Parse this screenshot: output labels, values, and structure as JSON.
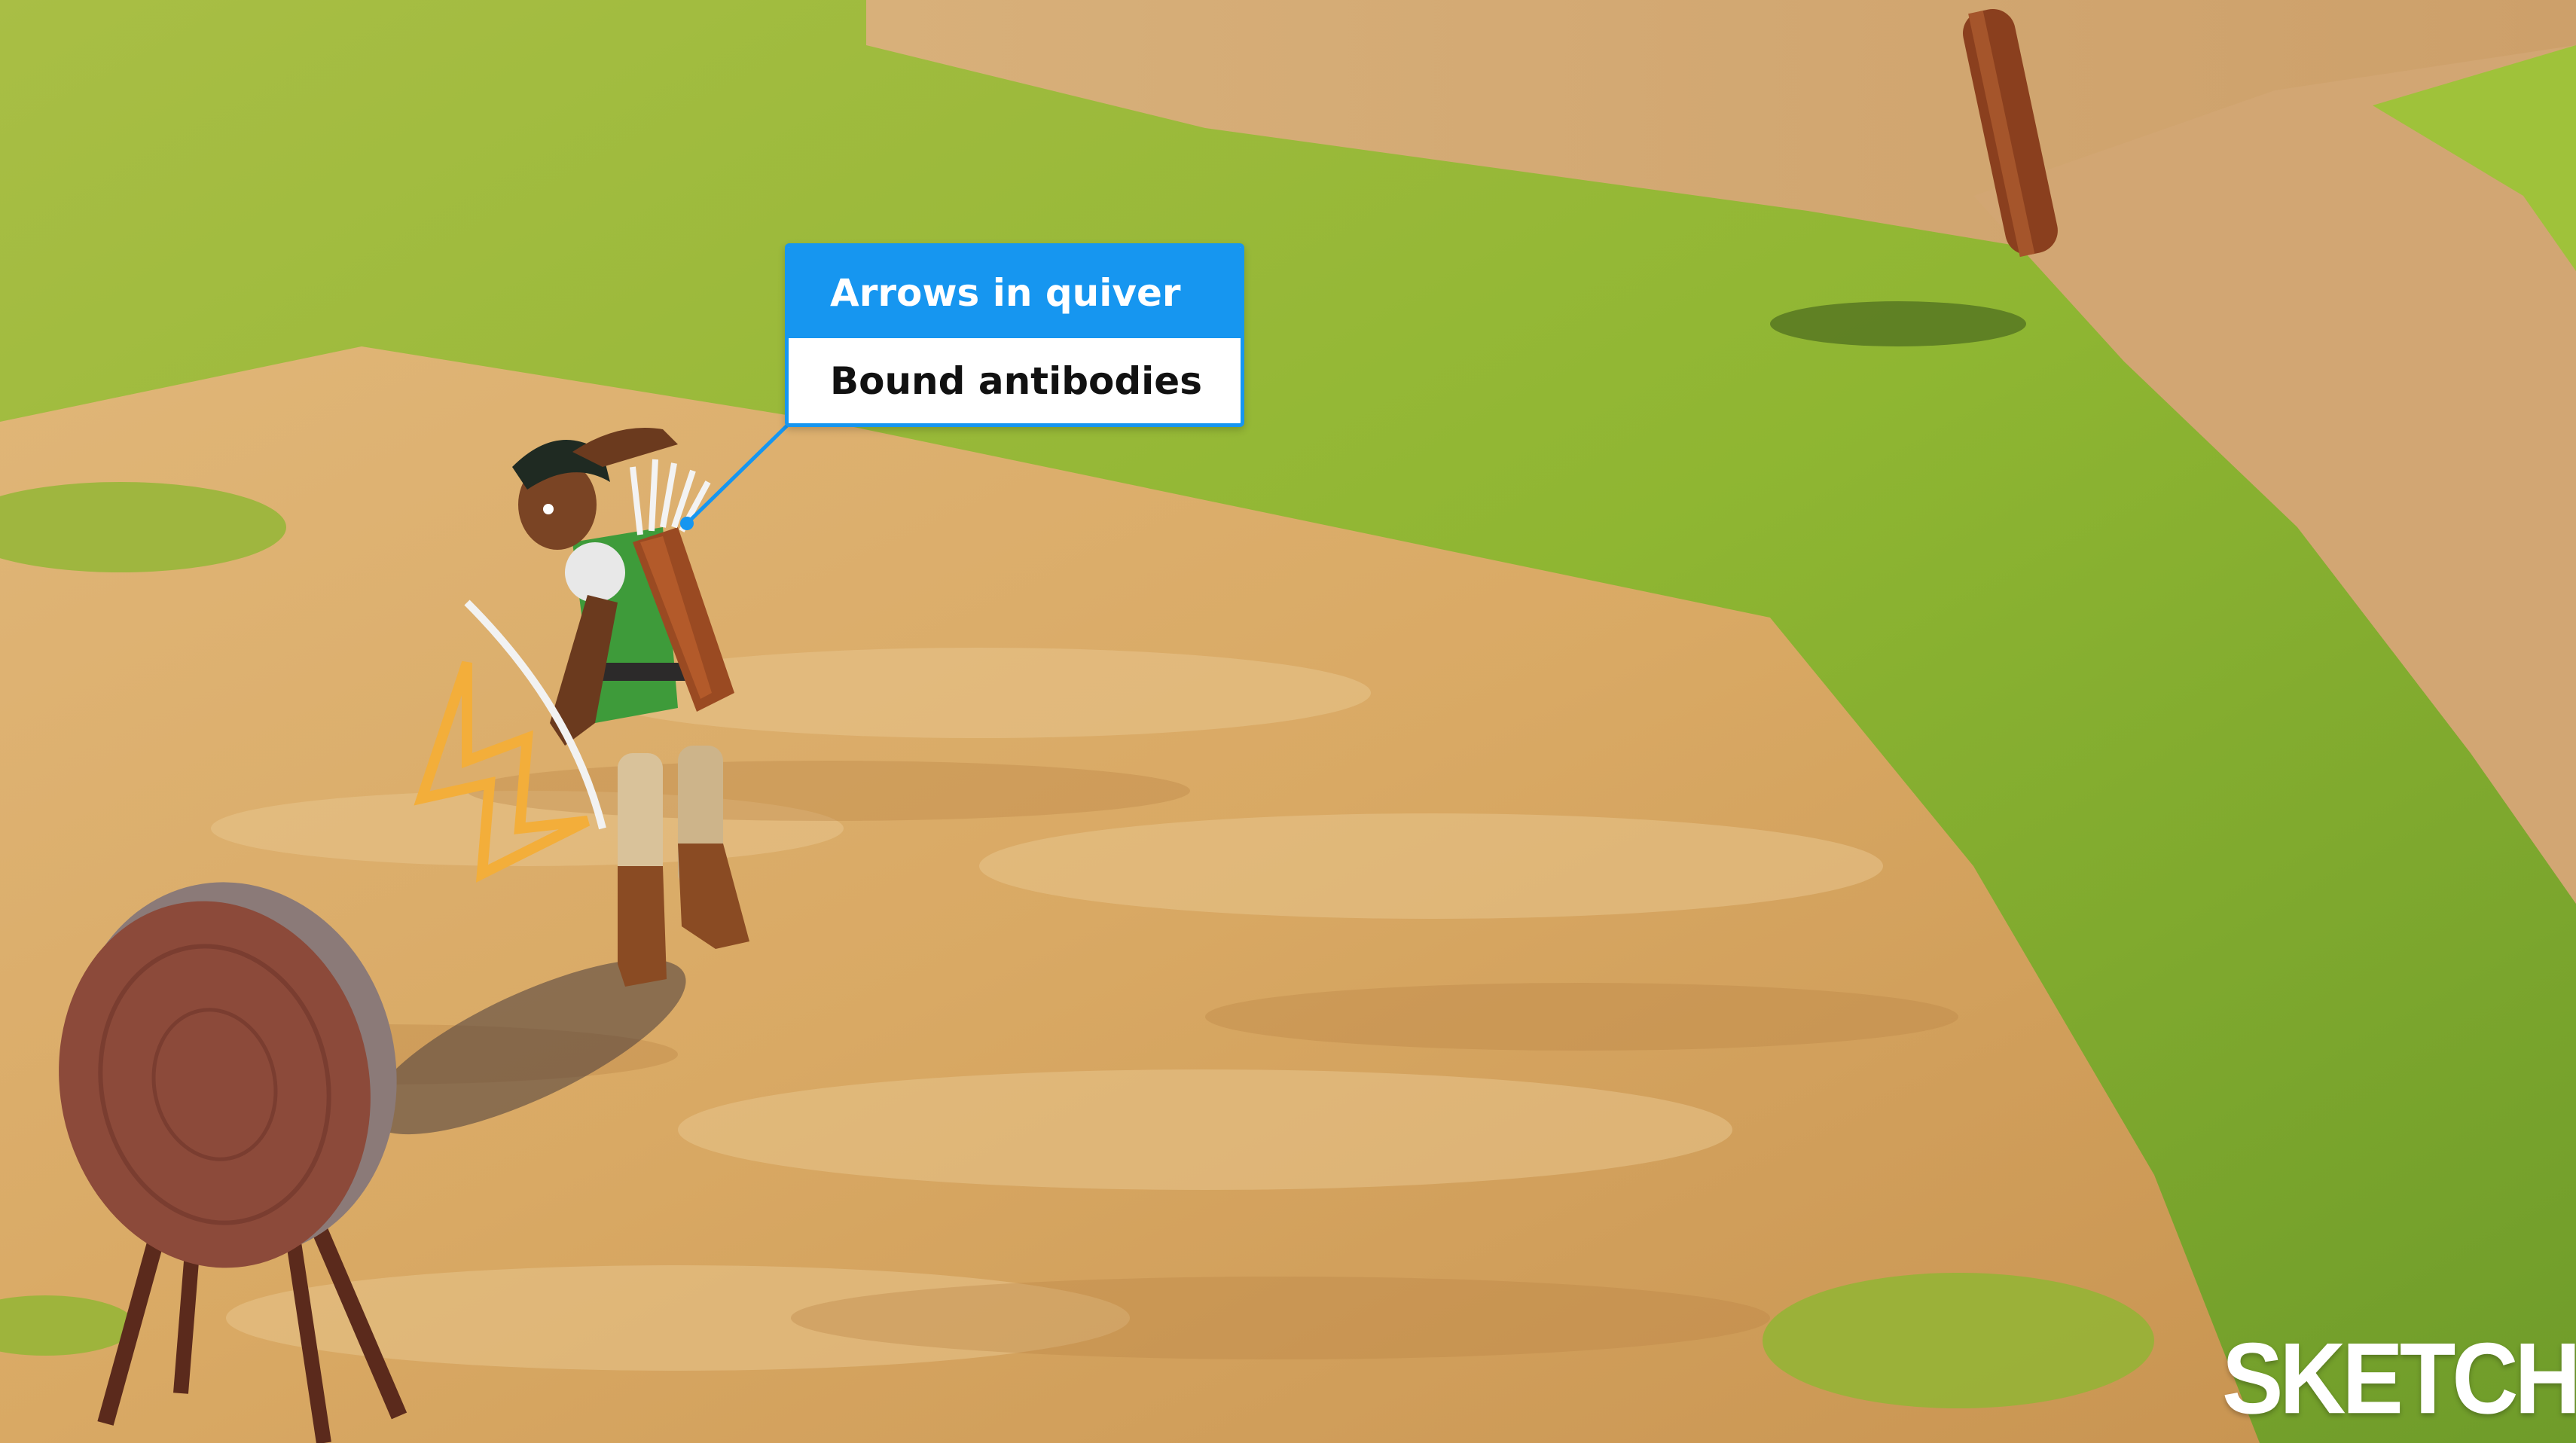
{
  "callout": {
    "title": "Arrows in quiver",
    "label": "Bound antibodies",
    "accent_color": "#1696f0"
  },
  "logo": {
    "text": "SKETCHY"
  },
  "colors": {
    "grass": "#8bb133",
    "sand": "#d6a866",
    "accent": "#1696f0"
  }
}
